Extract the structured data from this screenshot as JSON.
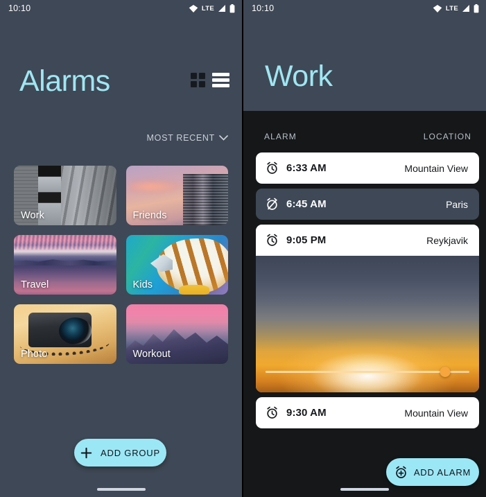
{
  "statusbar": {
    "time": "10:10",
    "network_label": "LTE",
    "icons": [
      "wifi-icon",
      "lte-label",
      "signal-icon",
      "battery-icon"
    ]
  },
  "left_panel": {
    "title": "Alarms",
    "view_toggle": {
      "grid_icon": "grid-view-icon",
      "list_icon": "list-view-icon"
    },
    "sort": {
      "label": "MOST RECENT",
      "chevron_icon": "chevron-down-icon"
    },
    "groups": [
      {
        "label": "Work",
        "art": "art-work"
      },
      {
        "label": "Friends",
        "art": "art-friends"
      },
      {
        "label": "Travel",
        "art": "art-travel"
      },
      {
        "label": "Kids",
        "art": "art-kids"
      },
      {
        "label": "Photo",
        "art": "art-photo"
      },
      {
        "label": "Workout",
        "art": "art-workout"
      }
    ],
    "add_group": {
      "label": "ADD GROUP",
      "icon": "plus-icon"
    }
  },
  "right_panel": {
    "title": "Work",
    "columns": {
      "alarm": "ALARM",
      "location": "LOCATION"
    },
    "alarms": [
      {
        "time": "6:33 AM",
        "location": "Mountain View",
        "enabled": true,
        "icon": "alarm-clock-icon",
        "expanded": false
      },
      {
        "time": "6:45 AM",
        "location": "Paris",
        "enabled": false,
        "icon": "alarm-clock-off-icon",
        "expanded": false
      },
      {
        "time": "9:05 PM",
        "location": "Reykjavik",
        "enabled": true,
        "icon": "alarm-clock-icon",
        "expanded": true
      },
      {
        "time": "9:30 AM",
        "location": "Mountain View",
        "enabled": true,
        "icon": "alarm-clock-icon",
        "expanded": false
      }
    ],
    "expanded_preview": {
      "image": "sunset-photo",
      "slider_value_percent": 88
    },
    "add_alarm": {
      "label": "ADD ALARM",
      "icon": "alarm-plus-icon"
    }
  },
  "colors": {
    "accent_cyan": "#9ce7f5",
    "panel_slate": "#3f4856",
    "panel_dark": "#151719",
    "card_white": "#ffffff",
    "slider_thumb": "#f6a63c"
  }
}
